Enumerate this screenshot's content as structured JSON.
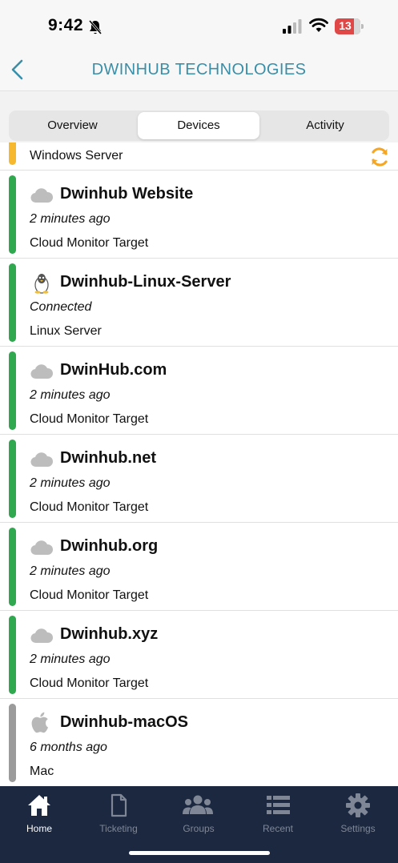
{
  "status_bar": {
    "time": "9:42",
    "battery": "13"
  },
  "nav": {
    "title": "DWINHUB TECHNOLOGIES"
  },
  "segments": [
    {
      "label": "Overview"
    },
    {
      "label": "Devices"
    },
    {
      "label": "Activity"
    }
  ],
  "partial_device": {
    "type": "Windows Server",
    "status_color": "#f5b82e"
  },
  "devices": [
    {
      "name": "Dwinhub Website",
      "status": "2 minutes ago",
      "type": "Cloud Monitor Target",
      "icon": "cloud-icon",
      "status_color": "#2fa84f"
    },
    {
      "name": "Dwinhub-Linux-Server",
      "status": "Connected",
      "type": "Linux Server",
      "icon": "linux-tux-icon",
      "status_color": "#2fa84f"
    },
    {
      "name": "DwinHub.com",
      "status": "2 minutes ago",
      "type": "Cloud Monitor Target",
      "icon": "cloud-icon",
      "status_color": "#2fa84f"
    },
    {
      "name": "Dwinhub.net",
      "status": "2 minutes ago",
      "type": "Cloud Monitor Target",
      "icon": "cloud-icon",
      "status_color": "#2fa84f"
    },
    {
      "name": "Dwinhub.org",
      "status": "2 minutes ago",
      "type": "Cloud Monitor Target",
      "icon": "cloud-icon",
      "status_color": "#2fa84f"
    },
    {
      "name": "Dwinhub.xyz",
      "status": "2 minutes ago",
      "type": "Cloud Monitor Target",
      "icon": "cloud-icon",
      "status_color": "#2fa84f"
    },
    {
      "name": "Dwinhub-macOS",
      "status": "6 months ago",
      "type": "Mac",
      "icon": "apple-icon",
      "status_color": "#9b9b9b"
    }
  ],
  "tab_bar": [
    {
      "label": "Home",
      "icon": "home-icon"
    },
    {
      "label": "Ticketing",
      "icon": "document-icon"
    },
    {
      "label": "Groups",
      "icon": "groups-icon"
    },
    {
      "label": "Recent",
      "icon": "list-icon"
    },
    {
      "label": "Settings",
      "icon": "gear-icon"
    }
  ],
  "colors": {
    "accent": "#3a8fa8",
    "tab_bar_bg": "#1c2840",
    "refresh": "#f5a623"
  }
}
